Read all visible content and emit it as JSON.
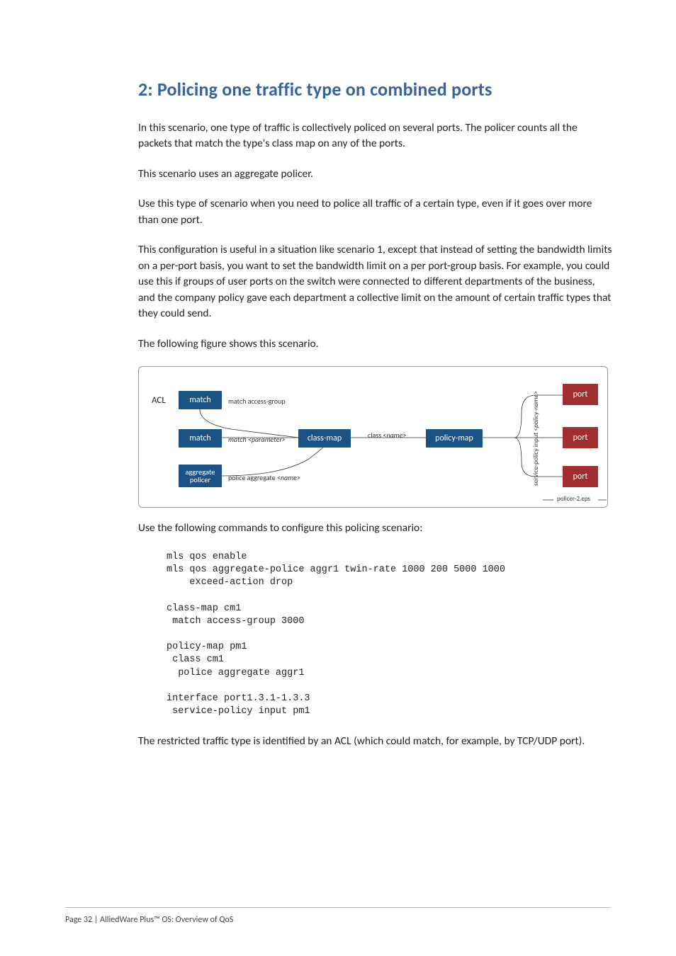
{
  "heading": "2: Policing one traffic type on combined ports",
  "p1": "In this scenario, one type of traffic is collectively policed on several ports. The policer counts all the packets that match the type's class map on any of the ports.",
  "p2": "This scenario uses an aggregate policer.",
  "p3": "Use this type of scenario when you need to police all traffic of a certain type, even if it goes over more than one port.",
  "p4": "This configuration is useful in a situation like scenario 1, except that instead of setting the bandwidth limits on a per-port basis, you want to set the bandwidth limit on a per port-group basis. For example, you could use this if groups of user ports on the switch were connected to different departments of the business, and the company policy gave each department a collective limit on the amount of certain traffic types that they could send.",
  "p5": "The following figure shows this scenario.",
  "p6": "Use the following commands to configure this policing scenario:",
  "p7": "The restricted traffic type is identified by an ACL (which could match, for example, by TCP/UDP port).",
  "code": "mls qos enable\nmls qos aggregate-police aggr1 twin-rate 1000 200 5000 1000 \n    exceed-action drop\n\nclass-map cm1\n match access-group 3000\n\npolicy-map pm1\n class cm1\n  police aggregate aggr1\n\ninterface port1.3.1-1.3.3\n service-policy input pm1",
  "diagram": {
    "acl": "ACL",
    "match": "match",
    "aggregate_policer": "aggregate policer",
    "match_access_group": "match access-group",
    "match_parameter": "match <parameter>",
    "police_aggregate": "police aggregate <name>",
    "class_map": "class-map",
    "class_name": "class <name>",
    "policy_map": "policy-map",
    "service_policy": "service-policy input <policy-name>",
    "port": "port",
    "eps": "policer-2.eps"
  },
  "footer": "Page 32 | AlliedWare Plus™ OS: Overview of QoS"
}
